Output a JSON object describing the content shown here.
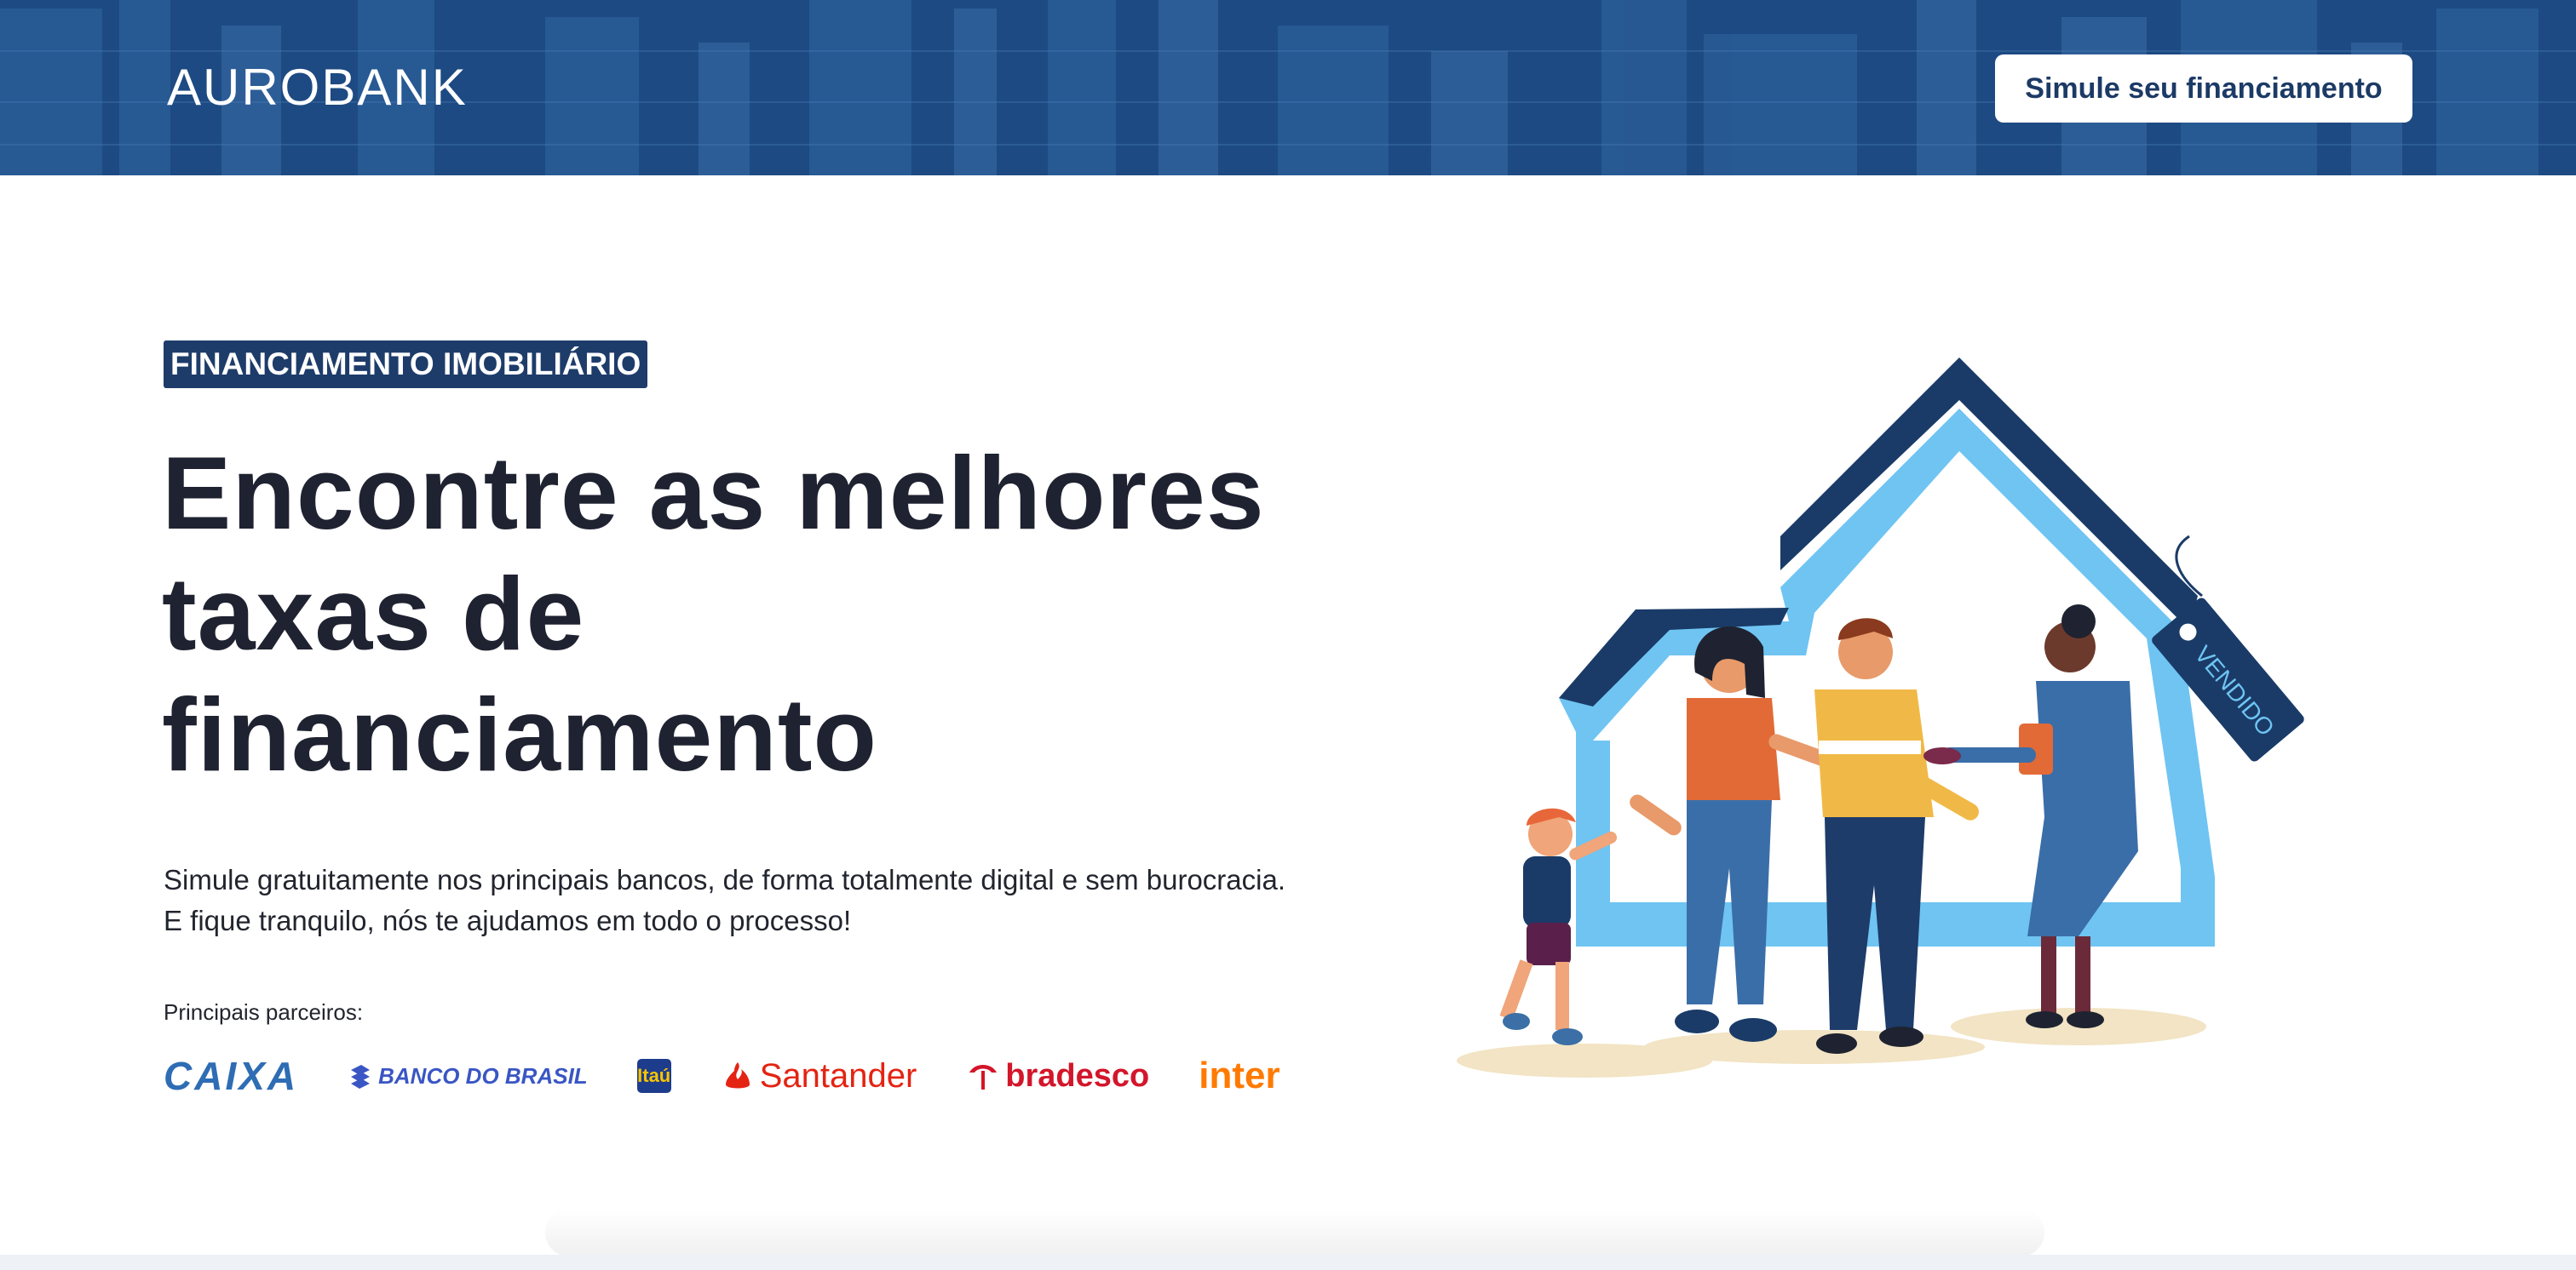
{
  "header": {
    "logo_text": "AUROBANK",
    "logo_rest": "UROBANK",
    "cta_label": "Simule seu financiamento"
  },
  "hero": {
    "badge": "FINANCIAMENTO IMOBILIÁRIO",
    "headline_line1": "Encontre as melhores",
    "headline_line2": "taxas de",
    "headline_line3": "financiamento",
    "subtext": "Simule gratuitamente nos principais bancos, de forma totalmente digital e sem burocracia. E fique tranquilo, nós te ajudamos em todo o processo!",
    "partners_label": "Principais parceiros:",
    "partners": [
      {
        "name": "CAIXA",
        "color": "#2e6db4"
      },
      {
        "name": "BANCO DO BRASIL",
        "color": "#3a56c4"
      },
      {
        "name": "Itaú",
        "color": "#1d3c8c"
      },
      {
        "name": "Santander",
        "color": "#e42313"
      },
      {
        "name": "bradesco",
        "color": "#d3162a"
      },
      {
        "name": "inter",
        "color": "#ff7a00"
      }
    ]
  },
  "illustration": {
    "tag_text": "VENDIDO"
  },
  "colors": {
    "header_bg": "#1d4a82",
    "badge_bg": "#1d3c6a",
    "text_dark": "#1f2230",
    "house_light": "#6fc4f2",
    "house_dark": "#1a3b68"
  }
}
